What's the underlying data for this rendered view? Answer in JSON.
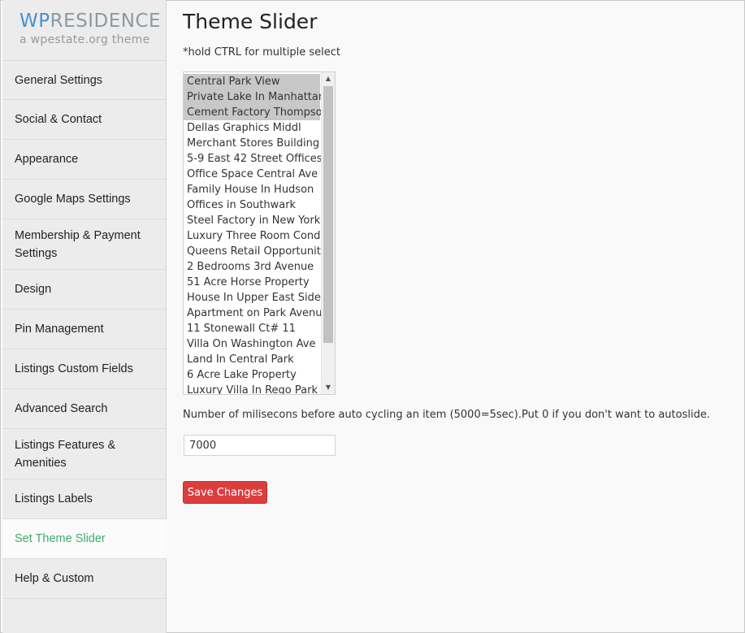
{
  "logo": {
    "brand_wp": "WP",
    "brand_rest": "RESIDENCE",
    "tagline": "a wpestate.org theme"
  },
  "sidebar": {
    "items": [
      {
        "label": "General Settings"
      },
      {
        "label": "Social & Contact"
      },
      {
        "label": "Appearance"
      },
      {
        "label": "Google Maps Settings"
      },
      {
        "label": "Membership & Payment Settings"
      },
      {
        "label": "Design"
      },
      {
        "label": "Pin Management"
      },
      {
        "label": "Listings Custom Fields"
      },
      {
        "label": "Advanced Search"
      },
      {
        "label": "Listings Features & Amenities"
      },
      {
        "label": "Listings Labels"
      },
      {
        "label": "Set Theme Slider"
      },
      {
        "label": "Help & Custom"
      }
    ],
    "active_index": 11
  },
  "main": {
    "title": "Theme Slider",
    "hint": "*hold CTRL for multiple select",
    "listings": [
      {
        "label": "Central Park View",
        "selected": true
      },
      {
        "label": "Private Lake In Manhattan",
        "selected": true
      },
      {
        "label": "Cement Factory Thompson",
        "selected": true
      },
      {
        "label": "Dellas Graphics Middl",
        "selected": false
      },
      {
        "label": "Merchant Stores Building",
        "selected": false
      },
      {
        "label": "5-9 East 42 Street Offices",
        "selected": false
      },
      {
        "label": "Office Space Central Ave",
        "selected": false
      },
      {
        "label": "Family House In Hudson",
        "selected": false
      },
      {
        "label": "Offices in Southwark",
        "selected": false
      },
      {
        "label": "Steel Factory in New York",
        "selected": false
      },
      {
        "label": "Luxury Three Room Condo",
        "selected": false
      },
      {
        "label": "Queens Retail Opportunity",
        "selected": false
      },
      {
        "label": "2 Bedrooms 3rd Avenue",
        "selected": false
      },
      {
        "label": "51 Acre Horse Property",
        "selected": false
      },
      {
        "label": "House In Upper East Side",
        "selected": false
      },
      {
        "label": "Apartment on Park Avenue",
        "selected": false
      },
      {
        "label": "11 Stonewall Ct# 11",
        "selected": false
      },
      {
        "label": "Villa On Washington Ave",
        "selected": false
      },
      {
        "label": "Land In Central Park",
        "selected": false
      },
      {
        "label": "6 Acre Lake Property",
        "selected": false
      },
      {
        "label": "Luxury Villa In Rego Park",
        "selected": false
      }
    ],
    "autoslide_description": "Number of milisecons before auto cycling an item (5000=5sec).Put 0 if you don't want to autoslide.",
    "autoslide_value": "7000",
    "save_label": "Save Changes"
  },
  "colors": {
    "accent_active": "#3eac6b",
    "save_button": "#dc3e3e",
    "logo_wp": "#4a90c8"
  },
  "icons": {
    "scroll_up": "chevron-up-icon",
    "scroll_down": "chevron-down-icon"
  }
}
